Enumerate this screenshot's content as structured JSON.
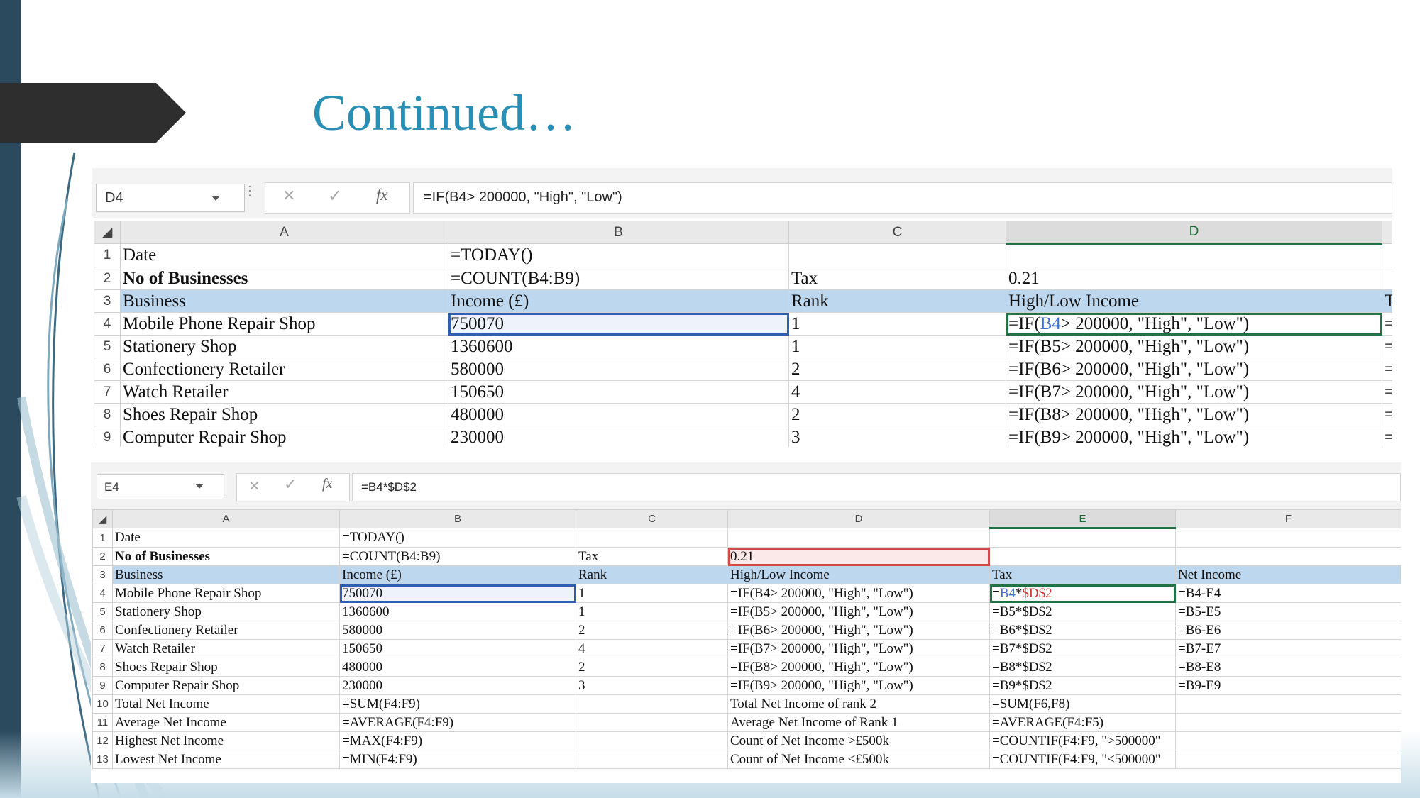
{
  "slide": {
    "title": "Continued…",
    "accent_color": "#2a8fb5",
    "dark_tab_color": "#2e2e2e",
    "left_strip_color": "#2b4a5e"
  },
  "screenshot1": {
    "name_box": "D4",
    "formula_bar": "=IF(B4> 200000, \"High\", \"Low\")",
    "buttons": {
      "cancel": "✕",
      "enter": "✓",
      "fx": "fx"
    },
    "columns": [
      "A",
      "B",
      "C",
      "D"
    ],
    "rows": [
      {
        "n": "1",
        "a": "Date",
        "b": "=TODAY()",
        "c": "",
        "d": ""
      },
      {
        "n": "2",
        "a": "No of Businesses",
        "b": "=COUNT(B4:B9)",
        "c": "Tax",
        "d": "0.21"
      },
      {
        "n": "3",
        "a": "Business",
        "b": "Income (£)",
        "c": "Rank",
        "d": "High/Low Income",
        "e": "T"
      },
      {
        "n": "4",
        "a": "Mobile Phone Repair Shop",
        "b": "750070",
        "c": "1",
        "d_pre": "=IF(",
        "d_ref": "B4",
        "d_post": "> 200000, \"High\", \"Low\")",
        "e": "="
      },
      {
        "n": "5",
        "a": "Stationery Shop",
        "b": "1360600",
        "c": "1",
        "d": "=IF(B5> 200000, \"High\", \"Low\")",
        "e": "="
      },
      {
        "n": "6",
        "a": "Confectionery Retailer",
        "b": "580000",
        "c": "2",
        "d": "=IF(B6> 200000, \"High\", \"Low\")",
        "e": "="
      },
      {
        "n": "7",
        "a": "Watch Retailer",
        "b": "150650",
        "c": "4",
        "d": "=IF(B7> 200000, \"High\", \"Low\")",
        "e": "="
      },
      {
        "n": "8",
        "a": "Shoes Repair Shop",
        "b": "480000",
        "c": "2",
        "d": "=IF(B8> 200000, \"High\", \"Low\")",
        "e": "="
      },
      {
        "n": "9",
        "a": "Computer Repair Shop",
        "b": "230000",
        "c": "3",
        "d": "=IF(B9> 200000, \"High\", \"Low\")",
        "e": "="
      }
    ]
  },
  "screenshot2": {
    "name_box": "E4",
    "formula_bar": "=B4*$D$2",
    "buttons": {
      "cancel": "✕",
      "enter": "✓",
      "fx": "fx"
    },
    "columns": [
      "A",
      "B",
      "C",
      "D",
      "E",
      "F"
    ],
    "rows": [
      {
        "n": "1",
        "a": "Date",
        "b": "=TODAY()",
        "c": "",
        "d": "",
        "e": "",
        "f": ""
      },
      {
        "n": "2",
        "a": "No of Businesses",
        "b": "=COUNT(B4:B9)",
        "c": "Tax",
        "d": "0.21",
        "e": "",
        "f": ""
      },
      {
        "n": "3",
        "a": "Business",
        "b": "Income (£)",
        "c": "Rank",
        "d": "High/Low Income",
        "e": "Tax",
        "f": "Net Income"
      },
      {
        "n": "4",
        "a": "Mobile Phone Repair Shop",
        "b": "750070",
        "c": "1",
        "d": "=IF(B4> 200000, \"High\", \"Low\")",
        "e_pre": "=",
        "e_ref1": "B4",
        "e_op": "*",
        "e_ref2": "$D$2",
        "f": "=B4-E4"
      },
      {
        "n": "5",
        "a": "Stationery Shop",
        "b": "1360600",
        "c": "1",
        "d": "=IF(B5> 200000, \"High\", \"Low\")",
        "e": "=B5*$D$2",
        "f": "=B5-E5"
      },
      {
        "n": "6",
        "a": "Confectionery Retailer",
        "b": "580000",
        "c": "2",
        "d": "=IF(B6> 200000, \"High\", \"Low\")",
        "e": "=B6*$D$2",
        "f": "=B6-E6"
      },
      {
        "n": "7",
        "a": "Watch Retailer",
        "b": "150650",
        "c": "4",
        "d": "=IF(B7> 200000, \"High\", \"Low\")",
        "e": "=B7*$D$2",
        "f": "=B7-E7"
      },
      {
        "n": "8",
        "a": "Shoes Repair Shop",
        "b": "480000",
        "c": "2",
        "d": "=IF(B8> 200000, \"High\", \"Low\")",
        "e": "=B8*$D$2",
        "f": "=B8-E8"
      },
      {
        "n": "9",
        "a": "Computer Repair Shop",
        "b": "230000",
        "c": "3",
        "d": "=IF(B9> 200000, \"High\", \"Low\")",
        "e": "=B9*$D$2",
        "f": "=B9-E9"
      },
      {
        "n": "10",
        "a": "Total Net Income",
        "b": "=SUM(F4:F9)",
        "c": "",
        "d": "Total Net Income of rank 2",
        "e": "=SUM(F6,F8)",
        "f": ""
      },
      {
        "n": "11",
        "a": "Average Net Income",
        "b": "=AVERAGE(F4:F9)",
        "c": "",
        "d": "Average Net Income of Rank 1",
        "e": "=AVERAGE(F4:F5)",
        "f": ""
      },
      {
        "n": "12",
        "a": "Highest Net Income",
        "b": "=MAX(F4:F9)",
        "c": "",
        "d": "Count of Net Income >£500k",
        "e": "=COUNTIF(F4:F9, \">500000\"",
        "f": ""
      },
      {
        "n": "13",
        "a": "Lowest Net Income",
        "b": "=MIN(F4:F9)",
        "c": "",
        "d": "Count of Net Income <£500k",
        "e": "=COUNTIF(F4:F9, \"<500000\"",
        "f": ""
      }
    ]
  }
}
